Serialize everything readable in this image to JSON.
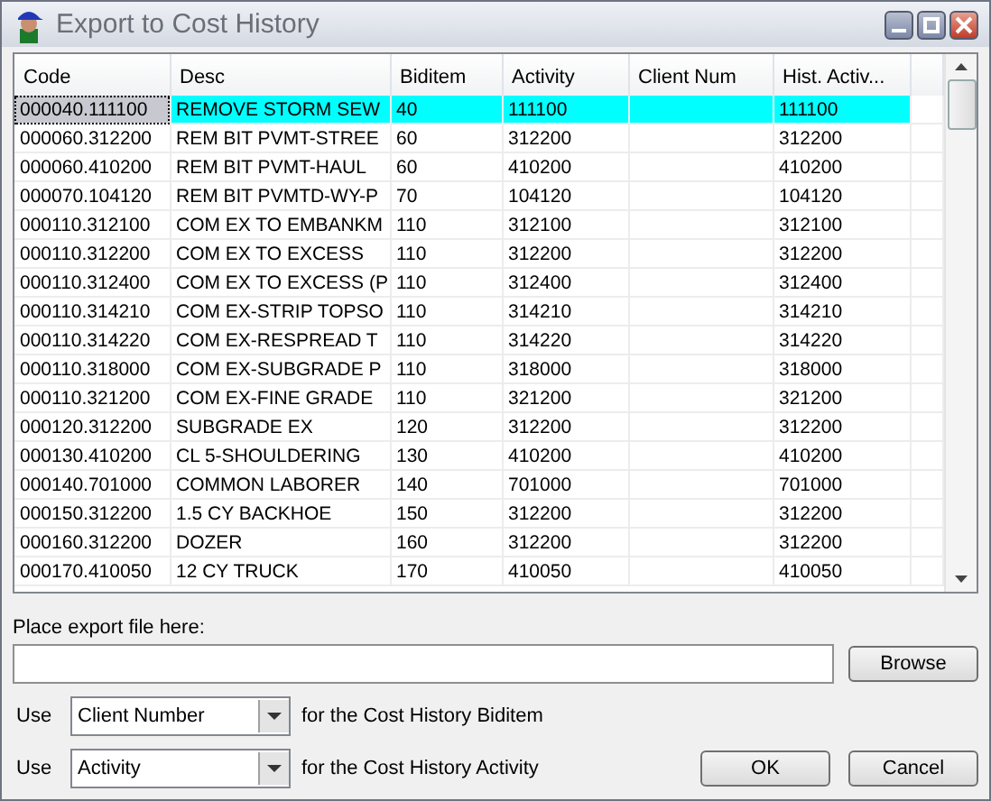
{
  "window": {
    "title": "Export to Cost History"
  },
  "table": {
    "columns": [
      "Code",
      "Desc",
      "Biditem",
      "Activity",
      "Client Num",
      "Hist. Activ..."
    ],
    "rows": [
      {
        "selected": true,
        "cells": [
          "000040.111100",
          "REMOVE STORM SEW",
          "40",
          "111100",
          "",
          "111100"
        ]
      },
      {
        "selected": false,
        "cells": [
          "000060.312200",
          "REM BIT PVMT-STREE",
          "60",
          "312200",
          "",
          "312200"
        ]
      },
      {
        "selected": false,
        "cells": [
          "000060.410200",
          "REM BIT PVMT-HAUL",
          "60",
          "410200",
          "",
          "410200"
        ]
      },
      {
        "selected": false,
        "cells": [
          "000070.104120",
          "REM BIT PVMTD-WY-P",
          "70",
          "104120",
          "",
          "104120"
        ]
      },
      {
        "selected": false,
        "cells": [
          "000110.312100",
          "COM EX TO EMBANKM",
          "110",
          "312100",
          "",
          "312100"
        ]
      },
      {
        "selected": false,
        "cells": [
          "000110.312200",
          "COM EX TO EXCESS",
          "110",
          "312200",
          "",
          "312200"
        ]
      },
      {
        "selected": false,
        "cells": [
          "000110.312400",
          "COM EX TO EXCESS (P",
          "110",
          "312400",
          "",
          "312400"
        ]
      },
      {
        "selected": false,
        "cells": [
          "000110.314210",
          "COM EX-STRIP TOPSO",
          "110",
          "314210",
          "",
          "314210"
        ]
      },
      {
        "selected": false,
        "cells": [
          "000110.314220",
          "COM EX-RESPREAD T",
          "110",
          "314220",
          "",
          "314220"
        ]
      },
      {
        "selected": false,
        "cells": [
          "000110.318000",
          "COM EX-SUBGRADE P",
          "110",
          "318000",
          "",
          "318000"
        ]
      },
      {
        "selected": false,
        "cells": [
          "000110.321200",
          "COM EX-FINE GRADE",
          "110",
          "321200",
          "",
          "321200"
        ]
      },
      {
        "selected": false,
        "cells": [
          "000120.312200",
          "SUBGRADE EX",
          "120",
          "312200",
          "",
          "312200"
        ]
      },
      {
        "selected": false,
        "cells": [
          "000130.410200",
          "CL 5-SHOULDERING",
          "130",
          "410200",
          "",
          "410200"
        ]
      },
      {
        "selected": false,
        "cells": [
          "000140.701000",
          "COMMON LABORER",
          "140",
          "701000",
          "",
          "701000"
        ]
      },
      {
        "selected": false,
        "cells": [
          "000150.312200",
          "1.5 CY BACKHOE",
          "150",
          "312200",
          "",
          "312200"
        ]
      },
      {
        "selected": false,
        "cells": [
          "000160.312200",
          "DOZER",
          "160",
          "312200",
          "",
          "312200"
        ]
      },
      {
        "selected": false,
        "cells": [
          "000170.410050",
          "12 CY TRUCK",
          "170",
          "410050",
          "",
          "410050"
        ]
      }
    ]
  },
  "export_file": {
    "label": "Place export file here:",
    "browse_button": "Browse"
  },
  "mappings": [
    {
      "use_label": "Use",
      "value": "Client Number",
      "suffix": "for the Cost History Biditem"
    },
    {
      "use_label": "Use",
      "value": "Activity",
      "suffix": "for the Cost History Activity"
    }
  ],
  "buttons": [
    "OK",
    "Cancel"
  ]
}
